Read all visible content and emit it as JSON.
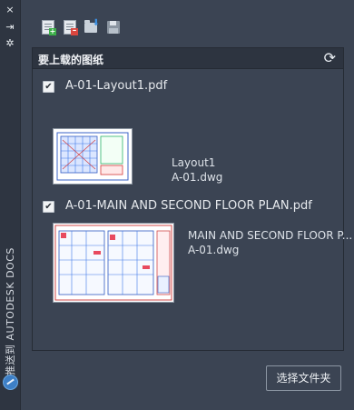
{
  "sidebar": {
    "close_icon": "×",
    "pin_icon": "⇥",
    "settings_icon": "✲",
    "vertical_label": "推送到 AUTODESK DOCS"
  },
  "toolbar": {
    "icons": [
      "add-sheets-icon",
      "remove-sheets-icon",
      "open-folder-icon",
      "save-icon"
    ]
  },
  "panel": {
    "title": "要上载的图纸",
    "refresh_icon": "⟳",
    "items": [
      {
        "checked": true,
        "filename": "A-01-Layout1.pdf",
        "layout": "Layout1",
        "dwg": "A-01.dwg"
      },
      {
        "checked": true,
        "filename": "A-01-MAIN AND SECOND FLOOR PLAN.pdf",
        "layout": "MAIN AND SECOND FLOOR P...",
        "dwg": "A-01.dwg"
      }
    ]
  },
  "footer": {
    "select_folder_label": "选择文件夹"
  },
  "colors": {
    "background": "#3b4453",
    "sidebar": "#2e3541",
    "header": "#2d3440",
    "accent": "#3d8fe0"
  }
}
